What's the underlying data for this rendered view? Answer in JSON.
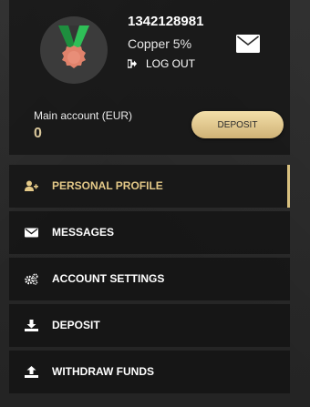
{
  "user": {
    "id": "1342128981",
    "level": "Copper 5%",
    "logout_label": "LOG OUT",
    "avatar_icon": "medal-icon"
  },
  "account": {
    "label": "Main account (EUR)",
    "value": "0",
    "deposit_label": "DEPOSIT"
  },
  "menu": {
    "items": [
      {
        "label": "PERSONAL PROFILE",
        "icon": "user-plus-icon",
        "active": true
      },
      {
        "label": "MESSAGES",
        "icon": "envelope-icon",
        "active": false
      },
      {
        "label": "ACCOUNT SETTINGS",
        "icon": "gears-icon",
        "active": false
      },
      {
        "label": "DEPOSIT",
        "icon": "download-icon",
        "active": false
      },
      {
        "label": "WITHDRAW FUNDS",
        "icon": "upload-icon",
        "active": false
      }
    ]
  },
  "colors": {
    "accent_gold": "#d8c07f",
    "panel_bg": "#141414",
    "medal_green": "#22a84a",
    "medal_copper": "#e0826b"
  }
}
